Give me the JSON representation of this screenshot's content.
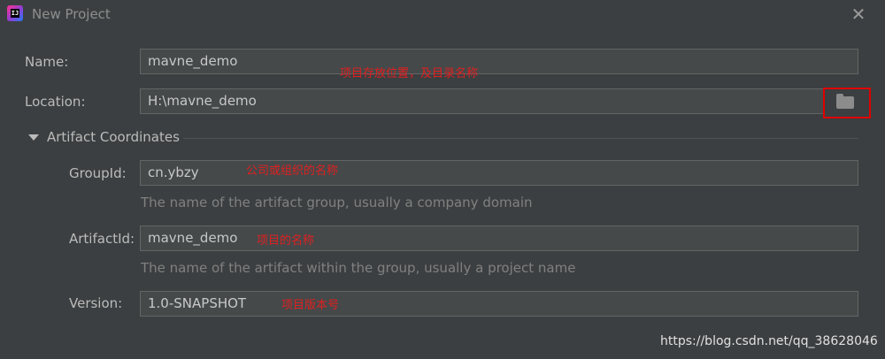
{
  "window": {
    "title": "New Project",
    "app_icon_text": "IJ"
  },
  "form": {
    "name": {
      "label": "Name:",
      "value": "mavne_demo",
      "note": "项目存放位置，及目录名称"
    },
    "location": {
      "label": "Location:",
      "value": "H:\\mavne_demo"
    },
    "artifact_section": {
      "title": "Artifact Coordinates"
    },
    "group_id": {
      "label": "GroupId:",
      "value": "cn.ybzy",
      "note": "公司或组织的名称",
      "hint": "The name of the artifact group, usually a company domain"
    },
    "artifact_id": {
      "label": "ArtifactId:",
      "value": "mavne_demo",
      "note": "项目的名称",
      "hint": "The name of the artifact within the group, usually a project name"
    },
    "version": {
      "label": "Version:",
      "value": "1.0-SNAPSHOT",
      "note": "项目版本号"
    }
  },
  "watermark": "https://blog.csdn.net/qq_38628046",
  "colors": {
    "background": "#3c3f41",
    "field_bg": "#45494a",
    "highlight": "#e00000",
    "note": "#e02020"
  }
}
